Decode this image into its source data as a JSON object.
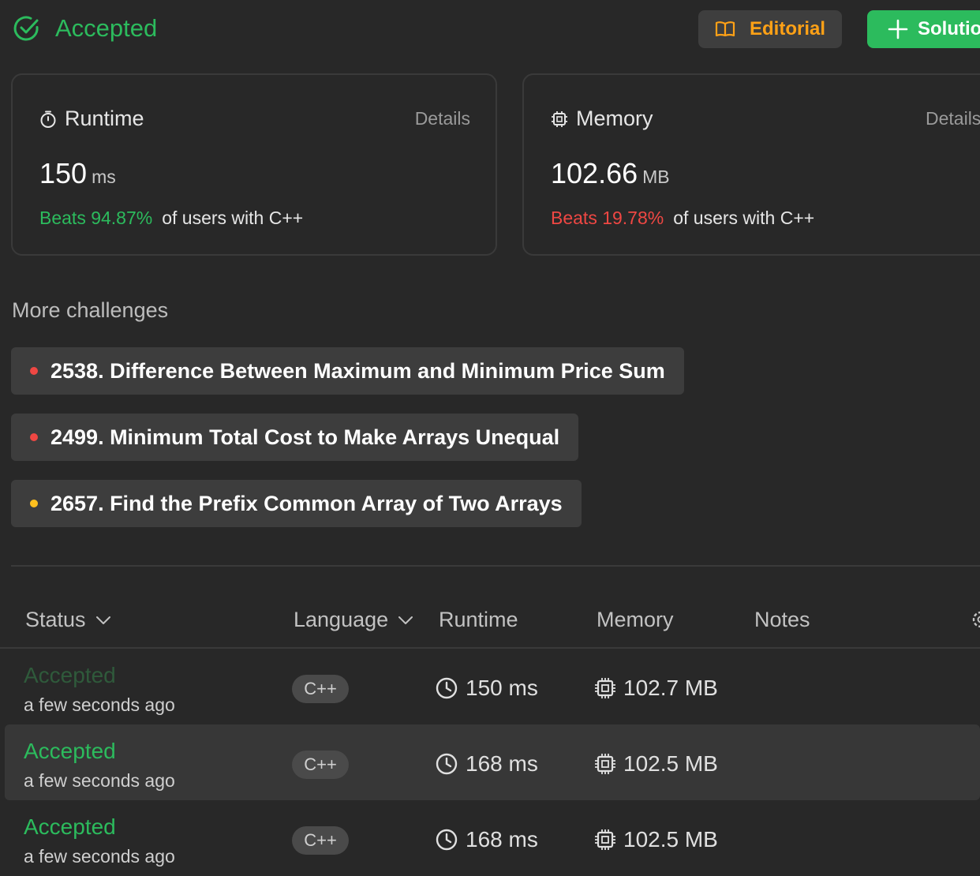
{
  "header": {
    "status": "Accepted",
    "editorial_label": "Editorial",
    "solution_label": "Solutio"
  },
  "runtime_card": {
    "label": "Runtime",
    "details": "Details",
    "value": "150",
    "unit": "ms",
    "beats": "Beats 94.87%",
    "beats_suffix": "of users with C++"
  },
  "memory_card": {
    "label": "Memory",
    "details": "Details",
    "value": "102.66",
    "unit": "MB",
    "beats": "Beats 19.78%",
    "beats_suffix": "of users with C++"
  },
  "more_challenges": {
    "title": "More challenges",
    "items": [
      {
        "label": "2538. Difference Between Maximum and Minimum Price Sum",
        "difficulty_color": "#ef4743"
      },
      {
        "label": "2499. Minimum Total Cost to Make Arrays Unequal",
        "difficulty_color": "#ef4743"
      },
      {
        "label": "2657. Find the Prefix Common Array of Two Arrays",
        "difficulty_color": "#ffc01e"
      }
    ]
  },
  "table": {
    "headers": {
      "status": "Status",
      "language": "Language",
      "runtime": "Runtime",
      "memory": "Memory",
      "notes": "Notes"
    },
    "rows": [
      {
        "status": "Accepted",
        "time": "a few seconds ago",
        "language": "C++",
        "runtime": "150 ms",
        "memory": "102.7 MB"
      },
      {
        "status": "Accepted",
        "time": "a few seconds ago",
        "language": "C++",
        "runtime": "168 ms",
        "memory": "102.5 MB"
      },
      {
        "status": "Accepted",
        "time": "a few seconds ago",
        "language": "C++",
        "runtime": "168 ms",
        "memory": "102.5 MB"
      }
    ]
  },
  "colors": {
    "accent_green": "#2cbb5d",
    "accent_orange": "#ffa116",
    "accent_red": "#ef4743",
    "accent_yellow": "#ffc01e"
  },
  "icons": [
    "check-circle-icon",
    "book-icon",
    "plus-icon",
    "timer-icon",
    "chip-icon",
    "chevron-down-icon",
    "clock-icon",
    "settings-icon"
  ]
}
